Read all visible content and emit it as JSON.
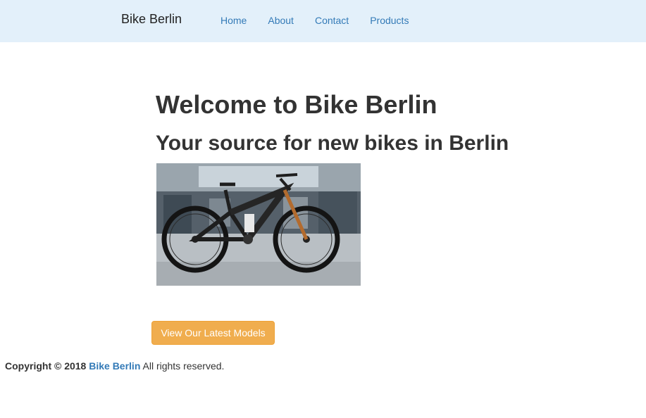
{
  "navbar": {
    "brand": "Bike Berlin",
    "links": [
      {
        "label": "Home"
      },
      {
        "label": "About"
      },
      {
        "label": "Contact"
      },
      {
        "label": "Products"
      }
    ]
  },
  "hero": {
    "title": "Welcome to Bike Berlin",
    "subtitle": "Your source for new bikes in Berlin",
    "image_subject": "mountain bike in workshop"
  },
  "cta": {
    "label": "View Our Latest Models",
    "color": "#f0ad4e"
  },
  "footer": {
    "prefix": "Copyright © 2018",
    "link": "Bike Berlin",
    "suffix": "All rights reserved."
  },
  "colors": {
    "navbar_bg": "#e3f0fa",
    "link": "#337ab7",
    "text": "#333333"
  }
}
